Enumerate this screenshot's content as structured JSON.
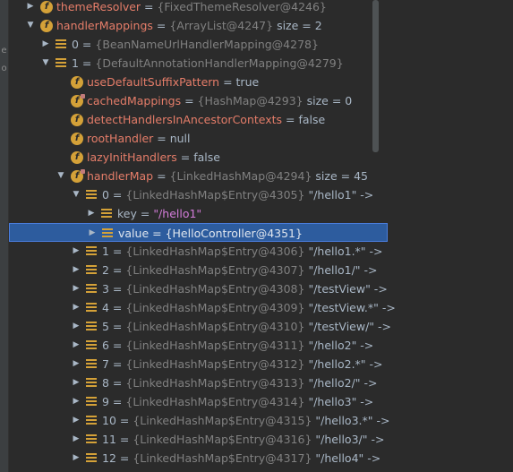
{
  "rows": [
    {
      "level": 2,
      "arrow": "right",
      "icon": "field",
      "name": "themeResolver",
      "type": "{FixedThemeResolver@4246}",
      "value": ""
    },
    {
      "level": 2,
      "arrow": "down",
      "icon": "field",
      "name": "handlerMappings",
      "type": "{ArrayList@4247}",
      "value": "size = 2"
    },
    {
      "level": 3,
      "arrow": "right",
      "icon": "list",
      "name": "0",
      "type": "{BeanNameUrlHandlerMapping@4278}",
      "value": ""
    },
    {
      "level": 3,
      "arrow": "down",
      "icon": "list",
      "name": "1",
      "type": "{DefaultAnnotationHandlerMapping@4279}",
      "value": ""
    },
    {
      "level": 4,
      "arrow": "",
      "icon": "field",
      "name": "useDefaultSuffixPattern",
      "type": "",
      "value": "true"
    },
    {
      "level": 4,
      "arrow": "",
      "icon": "field-lock",
      "name": "cachedMappings",
      "type": "{HashMap@4293}",
      "value": "size = 0"
    },
    {
      "level": 4,
      "arrow": "",
      "icon": "field",
      "name": "detectHandlersInAncestorContexts",
      "type": "",
      "value": "false"
    },
    {
      "level": 4,
      "arrow": "",
      "icon": "field",
      "name": "rootHandler",
      "type": "",
      "value": "null"
    },
    {
      "level": 4,
      "arrow": "",
      "icon": "field",
      "name": "lazyInitHandlers",
      "type": "",
      "value": "false"
    },
    {
      "level": 4,
      "arrow": "down",
      "icon": "field-lock",
      "name": "handlerMap",
      "type": "{LinkedHashMap@4294}",
      "value": "size = 45"
    },
    {
      "level": 5,
      "arrow": "down",
      "icon": "list",
      "name": "0",
      "type": "{LinkedHashMap$Entry@4305}",
      "value": "\"/hello1\" ->"
    },
    {
      "level": 6,
      "arrow": "right",
      "icon": "list",
      "name": "key",
      "type": "",
      "value": "\"/hello1\"",
      "string": true
    },
    {
      "level": 6,
      "arrow": "right",
      "icon": "list",
      "name": "value",
      "type": "{HelloController@4351}",
      "value": "",
      "selected": true
    },
    {
      "level": 5,
      "arrow": "right",
      "icon": "list",
      "name": "1",
      "type": "{LinkedHashMap$Entry@4306}",
      "value": "\"/hello1.*\" ->"
    },
    {
      "level": 5,
      "arrow": "right",
      "icon": "list",
      "name": "2",
      "type": "{LinkedHashMap$Entry@4307}",
      "value": "\"/hello1/\" ->"
    },
    {
      "level": 5,
      "arrow": "right",
      "icon": "list",
      "name": "3",
      "type": "{LinkedHashMap$Entry@4308}",
      "value": "\"/testView\" ->"
    },
    {
      "level": 5,
      "arrow": "right",
      "icon": "list",
      "name": "4",
      "type": "{LinkedHashMap$Entry@4309}",
      "value": "\"/testView.*\" ->"
    },
    {
      "level": 5,
      "arrow": "right",
      "icon": "list",
      "name": "5",
      "type": "{LinkedHashMap$Entry@4310}",
      "value": "\"/testView/\" ->"
    },
    {
      "level": 5,
      "arrow": "right",
      "icon": "list",
      "name": "6",
      "type": "{LinkedHashMap$Entry@4311}",
      "value": "\"/hello2\" ->"
    },
    {
      "level": 5,
      "arrow": "right",
      "icon": "list",
      "name": "7",
      "type": "{LinkedHashMap$Entry@4312}",
      "value": "\"/hello2.*\" ->"
    },
    {
      "level": 5,
      "arrow": "right",
      "icon": "list",
      "name": "8",
      "type": "{LinkedHashMap$Entry@4313}",
      "value": "\"/hello2/\" ->"
    },
    {
      "level": 5,
      "arrow": "right",
      "icon": "list",
      "name": "9",
      "type": "{LinkedHashMap$Entry@4314}",
      "value": "\"/hello3\" ->"
    },
    {
      "level": 5,
      "arrow": "right",
      "icon": "list",
      "name": "10",
      "type": "{LinkedHashMap$Entry@4315}",
      "value": "\"/hello3.*\" ->"
    },
    {
      "level": 5,
      "arrow": "right",
      "icon": "list",
      "name": "11",
      "type": "{LinkedHashMap$Entry@4316}",
      "value": "\"/hello3/\" ->"
    },
    {
      "level": 5,
      "arrow": "right",
      "icon": "list",
      "name": "12",
      "type": "{LinkedHashMap$Entry@4317}",
      "value": "\"/hello4\" ->"
    }
  ],
  "colors": {
    "background": "#2b2b2b",
    "field_name": "#e57d69",
    "type_text": "#808080",
    "value_text": "#a9b7c6",
    "string_value": "#d37cd9",
    "icon": "#d4a138",
    "selection": "#2d5c9e"
  },
  "gutter": {
    "marks": [
      "e",
      "o"
    ]
  }
}
